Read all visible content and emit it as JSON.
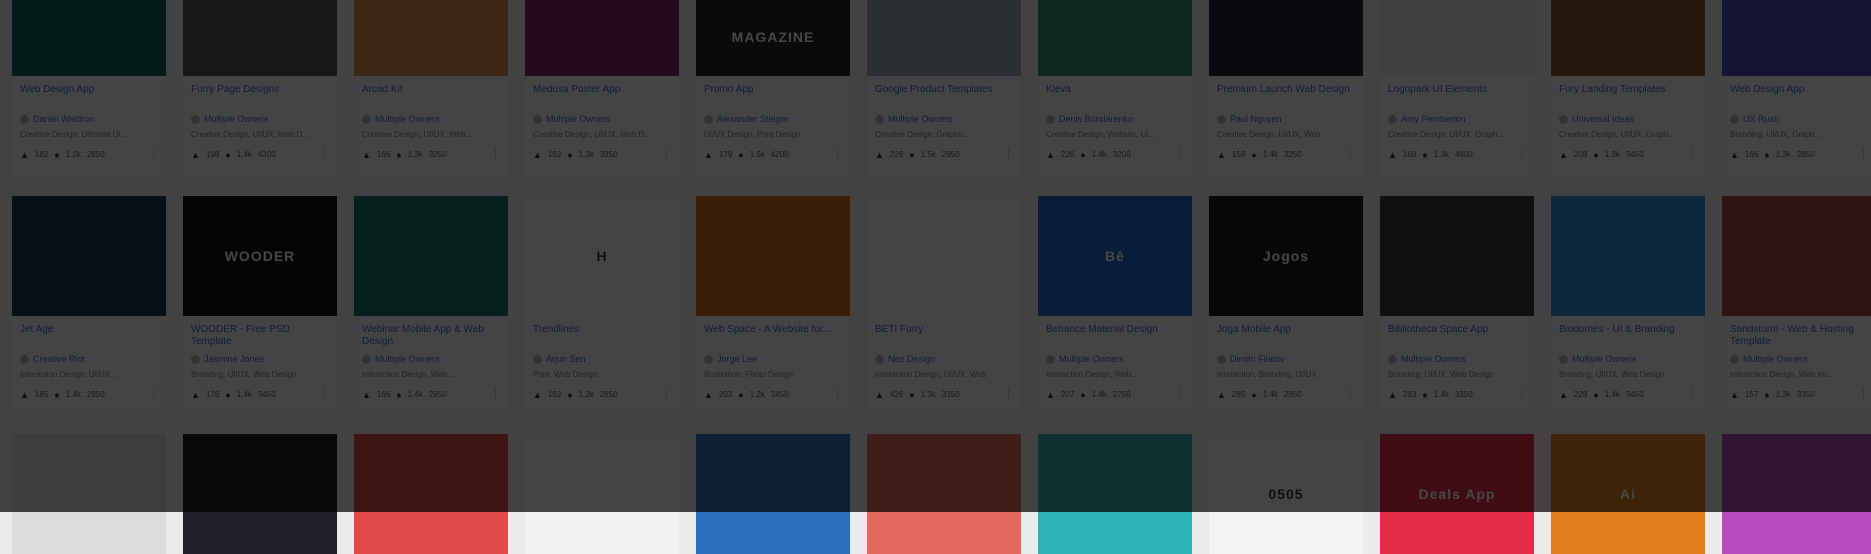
{
  "cards": [
    {
      "title": "Web Design App",
      "author": "Daniel Waldron",
      "tags": "Creative Design, Ultimate Ui...",
      "likes": "182",
      "views": "1.2k",
      "views2": "2850",
      "bg": "#10665a",
      "thumb_text": ""
    },
    {
      "title": "Furry Page Designs",
      "author": "Multiple Owners",
      "tags": "Creative Design, UI/UX, Web D...",
      "likes": "198",
      "views": "1.4k",
      "views2": "4300",
      "bg": "#5b5550",
      "thumb_text": ""
    },
    {
      "title": "Arcad Kit",
      "author": "Multiple Owners",
      "tags": "Creative Design, UI/UX, Web...",
      "likes": "166",
      "views": "1.3k",
      "views2": "3250",
      "bg": "#d7884a",
      "thumb_text": ""
    },
    {
      "title": "Medusa Poster App",
      "author": "Multiple Owners",
      "tags": "Creative Design, UI/UX, Web D...",
      "likes": "162",
      "views": "1.3k",
      "views2": "3350",
      "bg": "#8a1d6f",
      "thumb_text": ""
    },
    {
      "title": "Promo App",
      "author": "Alexander Steiger",
      "tags": "UI/UX Design, Print Design",
      "likes": "179",
      "views": "1.5k",
      "views2": "4200",
      "bg": "#262626",
      "thumb_text": "MAGAZINE"
    },
    {
      "title": "Google Product Templates",
      "author": "Multiple Owners",
      "tags": "Creative Design, Graphic...",
      "likes": "228",
      "views": "1.5k",
      "views2": "2950",
      "bg": "#9aa4b3",
      "thumb_text": ""
    },
    {
      "title": "Kleva",
      "author": "Denis Bondarenko",
      "tags": "Creative Design, Website, UI...",
      "likes": "226",
      "views": "1.4k",
      "views2": "3200",
      "bg": "#2e8e70",
      "thumb_text": ""
    },
    {
      "title": "Premium Launch Web Design",
      "author": "Paul Nguyen",
      "tags": "Creative Design, UI/UX, Web",
      "likes": "158",
      "views": "1.4k",
      "views2": "3250",
      "bg": "#242232",
      "thumb_text": ""
    },
    {
      "title": "Logopark UI Elements",
      "author": "Amy Pemberton",
      "tags": "Creative Design, UI/UX, Graph...",
      "likes": "160",
      "views": "1.3k",
      "views2": "4900",
      "bg": "#dfe4ee",
      "thumb_text": ""
    },
    {
      "title": "Fury Landing Templates",
      "author": "Universal Ideas",
      "tags": "Creative Design, UI/UX, Graph...",
      "likes": "208",
      "views": "1.3k",
      "views2": "3450",
      "bg": "#8a4c2a",
      "thumb_text": ""
    },
    {
      "title": "Web Design App",
      "author": "UX Rush",
      "tags": "Branding, UI/UX, Graph...",
      "likes": "166",
      "views": "1.3k",
      "views2": "2850",
      "bg": "#4e49c2",
      "thumb_text": ""
    },
    {
      "title": "Jet Age",
      "author": "Creative Riot",
      "tags": "Interaction Design, UI/UX...",
      "likes": "185",
      "views": "1.4k",
      "views2": "2950",
      "bg": "#133a52",
      "thumb_text": ""
    },
    {
      "title": "WOODER - Free PSD Template",
      "author": "Jasmine Jones",
      "tags": "Branding, UI/UX, Web Design",
      "likes": "176",
      "views": "1.4k",
      "views2": "3450",
      "bg": "#111111",
      "thumb_text": "WOODER"
    },
    {
      "title": "Webinar Mobile App & Web Design",
      "author": "Multiple Owners",
      "tags": "Interaction Design, Web...",
      "likes": "166",
      "views": "1.4k",
      "views2": "2950",
      "bg": "#127165",
      "thumb_text": ""
    },
    {
      "title": "Trendlines",
      "author": "Arjun Sen",
      "tags": "Print, Web Design",
      "likes": "162",
      "views": "1.2k",
      "views2": "2850",
      "bg": "#f3f3f3",
      "thumb_text": "H"
    },
    {
      "title": "Web Space - A Website for...",
      "author": "Jorge Lee",
      "tags": "Illustration, Photo Design",
      "likes": "203",
      "views": "1.2k",
      "views2": "3450",
      "bg": "#d86a1e",
      "thumb_text": ""
    },
    {
      "title": "BETI Furry",
      "author": "Neo Design",
      "tags": "Interaction Design, UI/UX, Web",
      "likes": "426",
      "views": "1.3k",
      "views2": "3350",
      "bg": "#f4f4f4",
      "thumb_text": ""
    },
    {
      "title": "Behance Material Design",
      "author": "Multiple Owners",
      "tags": "Interaction Design, Web...",
      "likes": "207",
      "views": "1.4k",
      "views2": "2750",
      "bg": "#1f63c8",
      "thumb_text": "Bē"
    },
    {
      "title": "Joga Mobile App",
      "author": "Dimitri Filatov",
      "tags": "Interaction, Branding, UI/UX",
      "likes": "285",
      "views": "1.4k",
      "views2": "2850",
      "bg": "#1c1c1c",
      "thumb_text": "Jogos"
    },
    {
      "title": "Bibliotheca Space App",
      "author": "Multiple Owners",
      "tags": "Branding, UI/UX, Web Design",
      "likes": "283",
      "views": "1.4k",
      "views2": "3350",
      "bg": "#3a3a3a",
      "thumb_text": ""
    },
    {
      "title": "Biodomes - UI & Branding",
      "author": "Multiple Owners",
      "tags": "Branding, UI/UX, Web Design",
      "likes": "228",
      "views": "1.4k",
      "views2": "3450",
      "bg": "#2f8fd6",
      "thumb_text": ""
    },
    {
      "title": "Sandstorm - Web & Hosting Template",
      "author": "Multiple Owners",
      "tags": "Interaction Design, Web Inc...",
      "likes": "157",
      "views": "1.3k",
      "views2": "3350",
      "bg": "#a94a44",
      "thumb_text": ""
    },
    {
      "title": "",
      "author": "",
      "tags": "",
      "likes": "",
      "views": "",
      "views2": "",
      "bg": "#dcdcdc",
      "thumb_text": ""
    },
    {
      "title": "",
      "author": "",
      "tags": "",
      "likes": "",
      "views": "",
      "views2": "",
      "bg": "#20202a",
      "thumb_text": ""
    },
    {
      "title": "",
      "author": "",
      "tags": "",
      "likes": "",
      "views": "",
      "views2": "",
      "bg": "#e24a4a",
      "thumb_text": ""
    },
    {
      "title": "",
      "author": "",
      "tags": "",
      "likes": "",
      "views": "",
      "views2": "",
      "bg": "#f2f2f2",
      "thumb_text": ""
    },
    {
      "title": "",
      "author": "",
      "tags": "",
      "likes": "",
      "views": "",
      "views2": "",
      "bg": "#2d6fbf",
      "thumb_text": ""
    },
    {
      "title": "",
      "author": "",
      "tags": "",
      "likes": "",
      "views": "",
      "views2": "",
      "bg": "#e46a5e",
      "thumb_text": ""
    },
    {
      "title": "",
      "author": "",
      "tags": "",
      "likes": "",
      "views": "",
      "views2": "",
      "bg": "#2bb5b5",
      "thumb_text": ""
    },
    {
      "title": "",
      "author": "",
      "tags": "",
      "likes": "",
      "views": "",
      "views2": "",
      "bg": "#f4f4f4",
      "thumb_text": "0505"
    },
    {
      "title": "",
      "author": "",
      "tags": "",
      "likes": "",
      "views": "",
      "views2": "",
      "bg": "#e22b45",
      "thumb_text": "Deals App"
    },
    {
      "title": "",
      "author": "",
      "tags": "",
      "likes": "",
      "views": "",
      "views2": "",
      "bg": "#e07d1c",
      "thumb_text": "Ai"
    },
    {
      "title": "",
      "author": "",
      "tags": "",
      "likes": "",
      "views": "",
      "views2": "",
      "bg": "#b54bbe",
      "thumb_text": ""
    }
  ]
}
